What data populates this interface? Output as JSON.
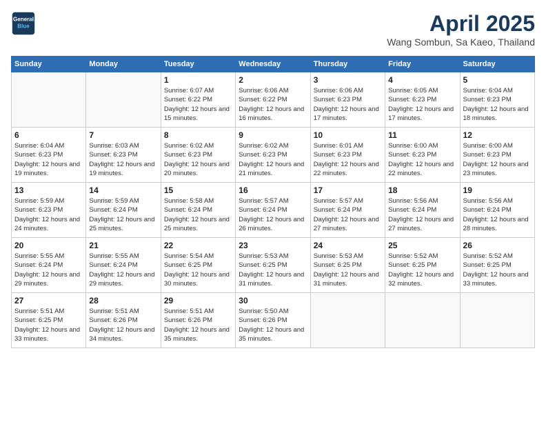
{
  "header": {
    "logo_line1": "General",
    "logo_line2": "Blue",
    "month": "April 2025",
    "location": "Wang Sombun, Sa Kaeo, Thailand"
  },
  "weekdays": [
    "Sunday",
    "Monday",
    "Tuesday",
    "Wednesday",
    "Thursday",
    "Friday",
    "Saturday"
  ],
  "weeks": [
    [
      {
        "day": "",
        "info": ""
      },
      {
        "day": "",
        "info": ""
      },
      {
        "day": "1",
        "info": "Sunrise: 6:07 AM\nSunset: 6:22 PM\nDaylight: 12 hours and 15 minutes."
      },
      {
        "day": "2",
        "info": "Sunrise: 6:06 AM\nSunset: 6:22 PM\nDaylight: 12 hours and 16 minutes."
      },
      {
        "day": "3",
        "info": "Sunrise: 6:06 AM\nSunset: 6:23 PM\nDaylight: 12 hours and 17 minutes."
      },
      {
        "day": "4",
        "info": "Sunrise: 6:05 AM\nSunset: 6:23 PM\nDaylight: 12 hours and 17 minutes."
      },
      {
        "day": "5",
        "info": "Sunrise: 6:04 AM\nSunset: 6:23 PM\nDaylight: 12 hours and 18 minutes."
      }
    ],
    [
      {
        "day": "6",
        "info": "Sunrise: 6:04 AM\nSunset: 6:23 PM\nDaylight: 12 hours and 19 minutes."
      },
      {
        "day": "7",
        "info": "Sunrise: 6:03 AM\nSunset: 6:23 PM\nDaylight: 12 hours and 19 minutes."
      },
      {
        "day": "8",
        "info": "Sunrise: 6:02 AM\nSunset: 6:23 PM\nDaylight: 12 hours and 20 minutes."
      },
      {
        "day": "9",
        "info": "Sunrise: 6:02 AM\nSunset: 6:23 PM\nDaylight: 12 hours and 21 minutes."
      },
      {
        "day": "10",
        "info": "Sunrise: 6:01 AM\nSunset: 6:23 PM\nDaylight: 12 hours and 22 minutes."
      },
      {
        "day": "11",
        "info": "Sunrise: 6:00 AM\nSunset: 6:23 PM\nDaylight: 12 hours and 22 minutes."
      },
      {
        "day": "12",
        "info": "Sunrise: 6:00 AM\nSunset: 6:23 PM\nDaylight: 12 hours and 23 minutes."
      }
    ],
    [
      {
        "day": "13",
        "info": "Sunrise: 5:59 AM\nSunset: 6:23 PM\nDaylight: 12 hours and 24 minutes."
      },
      {
        "day": "14",
        "info": "Sunrise: 5:59 AM\nSunset: 6:24 PM\nDaylight: 12 hours and 25 minutes."
      },
      {
        "day": "15",
        "info": "Sunrise: 5:58 AM\nSunset: 6:24 PM\nDaylight: 12 hours and 25 minutes."
      },
      {
        "day": "16",
        "info": "Sunrise: 5:57 AM\nSunset: 6:24 PM\nDaylight: 12 hours and 26 minutes."
      },
      {
        "day": "17",
        "info": "Sunrise: 5:57 AM\nSunset: 6:24 PM\nDaylight: 12 hours and 27 minutes."
      },
      {
        "day": "18",
        "info": "Sunrise: 5:56 AM\nSunset: 6:24 PM\nDaylight: 12 hours and 27 minutes."
      },
      {
        "day": "19",
        "info": "Sunrise: 5:56 AM\nSunset: 6:24 PM\nDaylight: 12 hours and 28 minutes."
      }
    ],
    [
      {
        "day": "20",
        "info": "Sunrise: 5:55 AM\nSunset: 6:24 PM\nDaylight: 12 hours and 29 minutes."
      },
      {
        "day": "21",
        "info": "Sunrise: 5:55 AM\nSunset: 6:24 PM\nDaylight: 12 hours and 29 minutes."
      },
      {
        "day": "22",
        "info": "Sunrise: 5:54 AM\nSunset: 6:25 PM\nDaylight: 12 hours and 30 minutes."
      },
      {
        "day": "23",
        "info": "Sunrise: 5:53 AM\nSunset: 6:25 PM\nDaylight: 12 hours and 31 minutes."
      },
      {
        "day": "24",
        "info": "Sunrise: 5:53 AM\nSunset: 6:25 PM\nDaylight: 12 hours and 31 minutes."
      },
      {
        "day": "25",
        "info": "Sunrise: 5:52 AM\nSunset: 6:25 PM\nDaylight: 12 hours and 32 minutes."
      },
      {
        "day": "26",
        "info": "Sunrise: 5:52 AM\nSunset: 6:25 PM\nDaylight: 12 hours and 33 minutes."
      }
    ],
    [
      {
        "day": "27",
        "info": "Sunrise: 5:51 AM\nSunset: 6:25 PM\nDaylight: 12 hours and 33 minutes."
      },
      {
        "day": "28",
        "info": "Sunrise: 5:51 AM\nSunset: 6:26 PM\nDaylight: 12 hours and 34 minutes."
      },
      {
        "day": "29",
        "info": "Sunrise: 5:51 AM\nSunset: 6:26 PM\nDaylight: 12 hours and 35 minutes."
      },
      {
        "day": "30",
        "info": "Sunrise: 5:50 AM\nSunset: 6:26 PM\nDaylight: 12 hours and 35 minutes."
      },
      {
        "day": "",
        "info": ""
      },
      {
        "day": "",
        "info": ""
      },
      {
        "day": "",
        "info": ""
      }
    ]
  ]
}
